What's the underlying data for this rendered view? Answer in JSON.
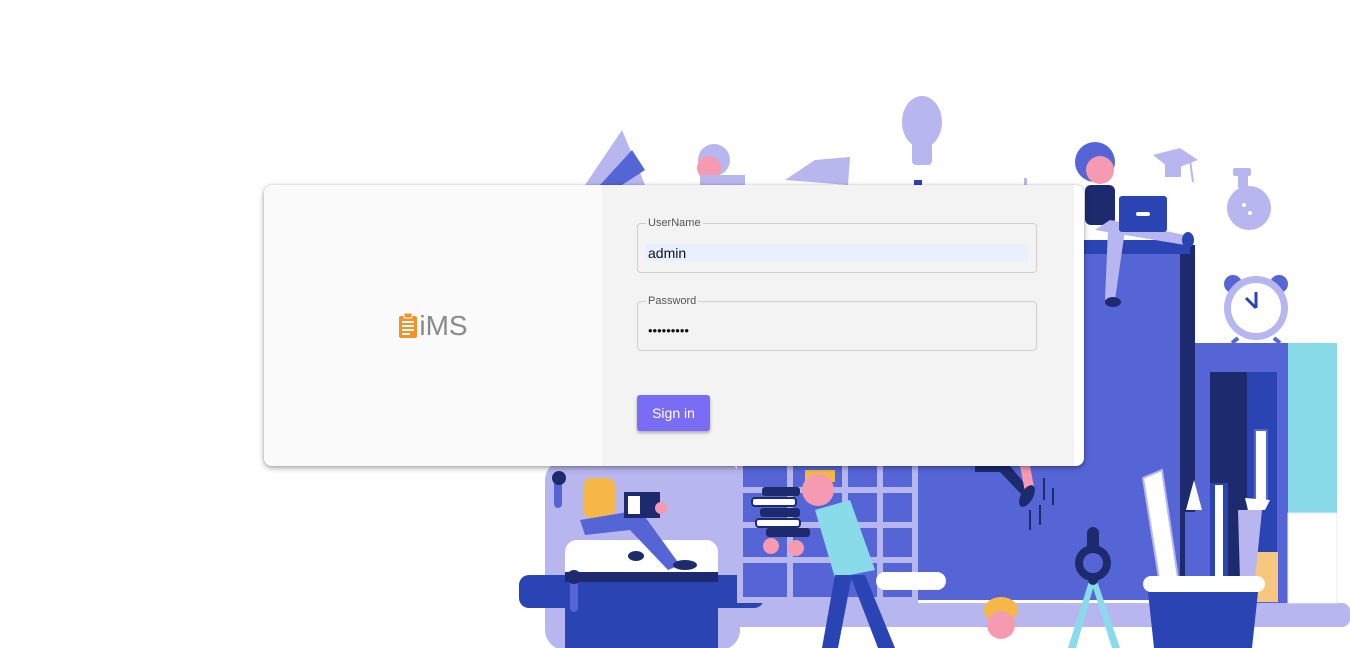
{
  "brand": {
    "logo_text": "iMS",
    "logo_icon": "clipboard-icon"
  },
  "login": {
    "username_label": "UserName",
    "username_value": "admin",
    "password_label": "Password",
    "password_value": "•••••••••",
    "signin_label": "Sign in"
  },
  "colors": {
    "accent": "#7b6cf6",
    "illustration_dark": "#2a44b3",
    "illustration_mid": "#5565d6",
    "illustration_light": "#b8b6ee",
    "illustration_cyan": "#8adbea",
    "logo_orange": "#f3922a"
  }
}
